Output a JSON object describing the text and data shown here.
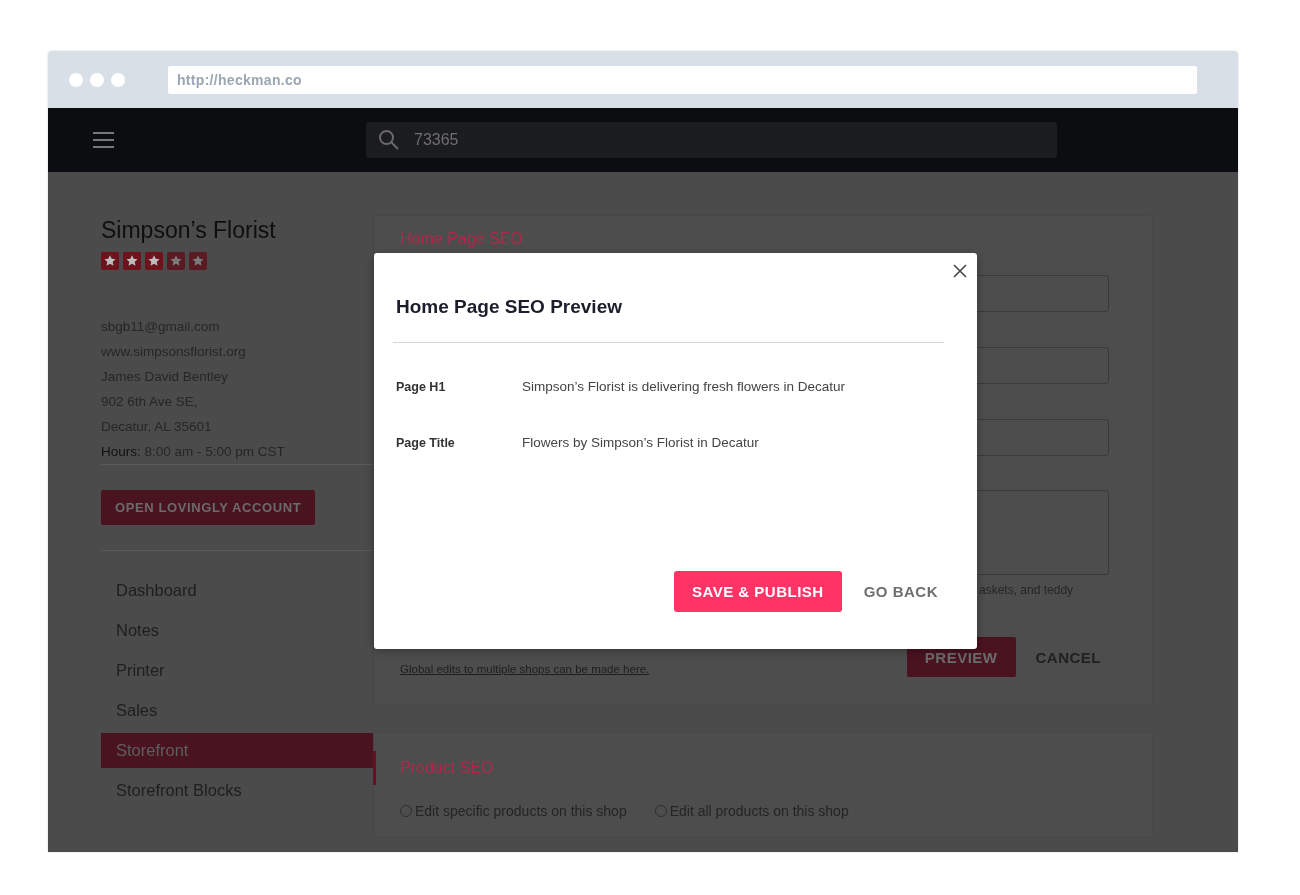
{
  "browser": {
    "url": "http://heckman.co"
  },
  "header": {
    "search_value": "73365"
  },
  "shop": {
    "name": "Simpson’s Florist",
    "stars": 3,
    "details": [
      "sbgb11@gmail.com",
      "www.simpsonsflorist.org",
      "James David Bentley",
      "902 6th Ave SE,",
      "Decatur, AL 35601"
    ],
    "hours_label": "Hours:",
    "hours": "8:00 am - 5:00 pm CST",
    "button": "OPEN LOVINGLY ACCOUNT"
  },
  "sidebar": {
    "items": [
      {
        "label": "Dashboard",
        "selected": false
      },
      {
        "label": "Notes",
        "selected": false
      },
      {
        "label": "Printer",
        "selected": false
      },
      {
        "label": "Sales",
        "selected": false
      },
      {
        "label": "Storefront",
        "selected": true
      },
      {
        "label": "Storefront Blocks",
        "selected": false
      }
    ]
  },
  "home_seo": {
    "title": "Home Page SEO",
    "hint": "askets, and teddy",
    "link": "Global edits to multiple shops can be made here.",
    "buttons": [
      "PREVIEW",
      "CANCEL"
    ]
  },
  "product_seo": {
    "title": "Product SEO",
    "options": [
      {
        "label": "Edit specific products on this shop",
        "selected": false
      },
      {
        "label": "Edit all products on this shop",
        "selected": false
      }
    ]
  },
  "modal": {
    "title": "Home Page SEO Preview",
    "rows": [
      {
        "label": "Page H1",
        "value": "Simpson’s Florist is delivering fresh flowers in Decatur"
      },
      {
        "label": "Page Title",
        "value": "Flowers by Simpson’s Florist in Decatur"
      }
    ],
    "buttons": [
      "SAVE & PUBLISH",
      "GO BACK"
    ]
  }
}
